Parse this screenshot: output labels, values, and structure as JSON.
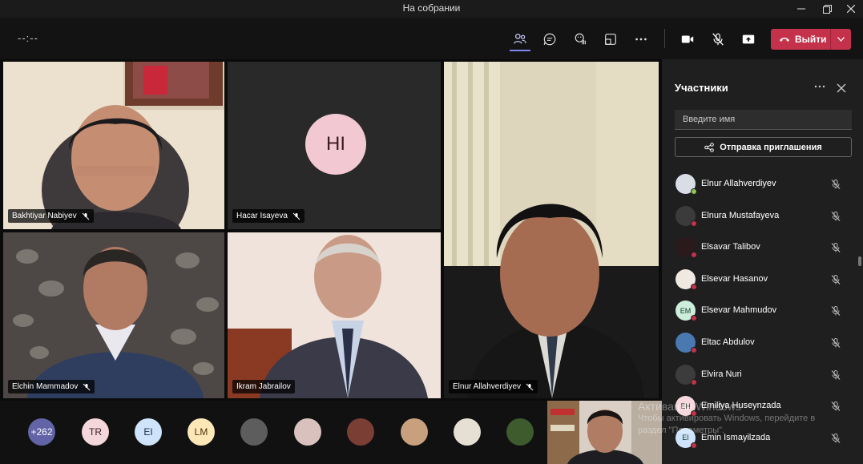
{
  "window": {
    "title": "На собрании"
  },
  "toolbar": {
    "timer": "--:--",
    "leave_label": "Выйти"
  },
  "tiles": [
    {
      "name": "Bakhtiyar Nabiyev"
    },
    {
      "name": "Hacar Isayeva",
      "initials": "HI"
    },
    {
      "name": "Elnur Allahverdiyev"
    },
    {
      "name": "Elchin Mammadov"
    },
    {
      "name": "Ikram Jabrailov"
    }
  ],
  "gallery": [
    {
      "label": "+262",
      "color": "#6264a7",
      "text_color": "#ffffff"
    },
    {
      "label": "TR",
      "color": "#f4d6dd",
      "text_color": "#3a1a24"
    },
    {
      "label": "EI",
      "color": "#cfe4fa",
      "text_color": "#1a2b4a"
    },
    {
      "label": "LM",
      "color": "#fde7b6",
      "text_color": "#4a3510"
    },
    {
      "label": "",
      "color": "#5d5d5d",
      "text_color": "#fff"
    },
    {
      "label": "",
      "color": "#d9c1bd",
      "text_color": "#fff"
    },
    {
      "label": "",
      "color": "#7a3e35",
      "text_color": "#fff"
    },
    {
      "label": "",
      "color": "#c9a07e",
      "text_color": "#fff"
    },
    {
      "label": "",
      "color": "#e6dfd4",
      "text_color": "#fff"
    },
    {
      "label": "",
      "color": "#3e5b2e",
      "text_color": "#fff"
    }
  ],
  "panel": {
    "title": "Участники",
    "search_placeholder": "Введите имя",
    "invite_label": "Отправка приглашения",
    "participants": [
      {
        "name": "Elnur Allahverdiyev",
        "initials": "",
        "color": "#d8dde6",
        "online": true
      },
      {
        "name": "Elnura Mustafayeva",
        "initials": "",
        "color": "#3b3b3b",
        "online": false
      },
      {
        "name": "Elsavar Talibov",
        "initials": "",
        "color": "#2a1a1c",
        "online": false
      },
      {
        "name": "Elsevar Hasanov",
        "initials": "",
        "color": "#efe9e2",
        "online": false
      },
      {
        "name": "Elsevar Mahmudov",
        "initials": "EM",
        "color": "#cdeedb",
        "online": false
      },
      {
        "name": "Eltac Abdulov",
        "initials": "",
        "color": "#4a78b0",
        "online": false
      },
      {
        "name": "Elvira Nuri",
        "initials": "",
        "color": "#3c3c3c",
        "online": false
      },
      {
        "name": "Emiliya Huseynzada",
        "initials": "EH",
        "color": "#f6d8de",
        "online": false
      },
      {
        "name": "Emin Ismayilzada",
        "initials": "EI",
        "color": "#cfe4fa",
        "online": false
      }
    ]
  },
  "watermark": {
    "line1": "Активация Windows",
    "line2": "Чтобы активировать Windows, перейдите в",
    "line3": "раздел \"Параметры\"."
  }
}
